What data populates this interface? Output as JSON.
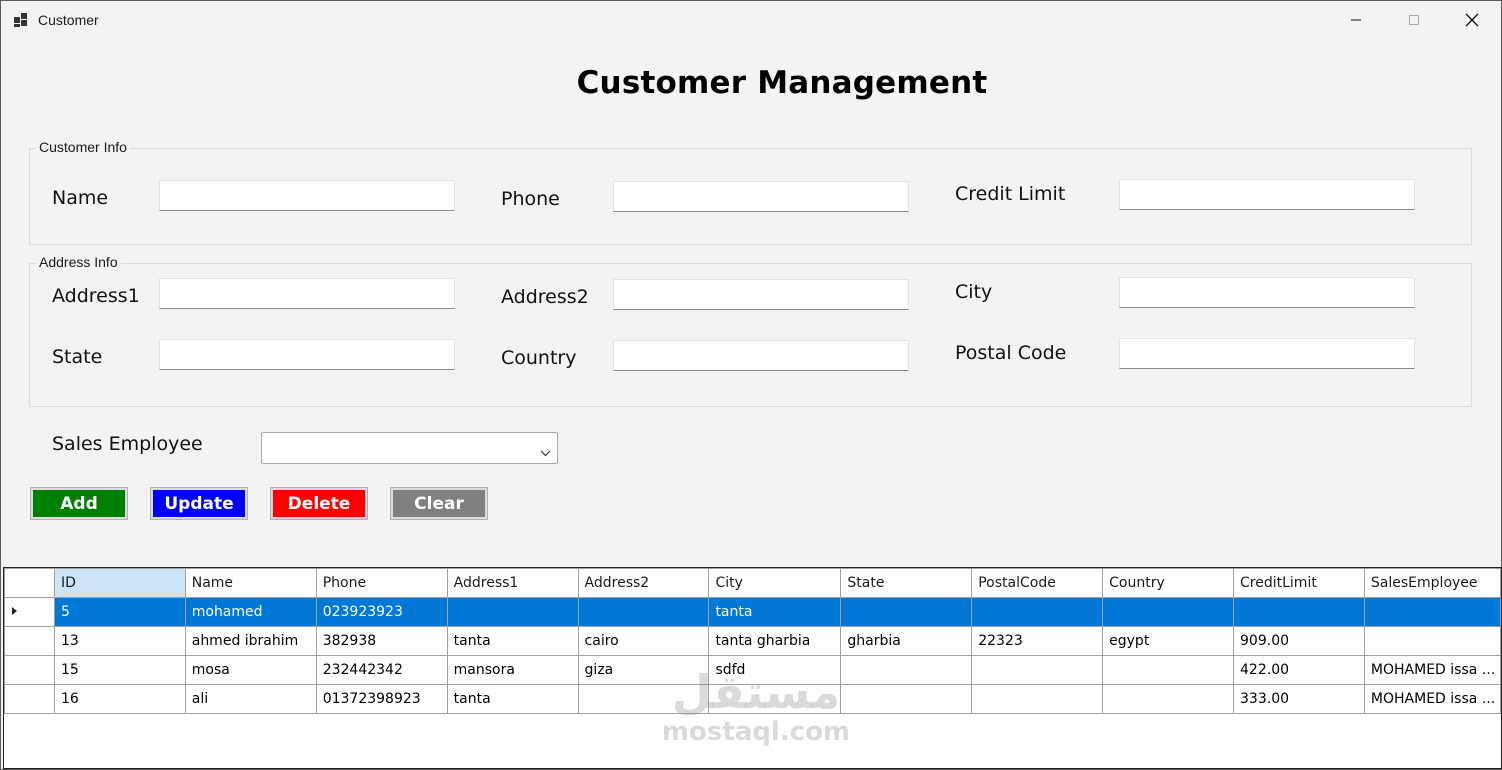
{
  "window": {
    "title": "Customer"
  },
  "header": {
    "title": "Customer Management"
  },
  "customer_info": {
    "legend": "Customer Info",
    "name_label": "Name",
    "name_value": "",
    "phone_label": "Phone",
    "phone_value": "",
    "credit_label": "Credit Limit",
    "credit_value": ""
  },
  "address_info": {
    "legend": "Address Info",
    "address1_label": "Address1",
    "address1_value": "",
    "address2_label": "Address2",
    "address2_value": "",
    "city_label": "City",
    "city_value": "",
    "state_label": "State",
    "state_value": "",
    "country_label": "Country",
    "country_value": "",
    "postal_label": "Postal Code",
    "postal_value": ""
  },
  "sales": {
    "label": "Sales Employee",
    "selected": ""
  },
  "buttons": {
    "add": "Add",
    "update": "Update",
    "delete": "Delete",
    "clear": "Clear",
    "colors": {
      "add": "#008000",
      "update": "#0000ff",
      "delete": "#ff0000",
      "clear": "#808080"
    }
  },
  "grid": {
    "columns": [
      "ID",
      "Name",
      "Phone",
      "Address1",
      "Address2",
      "City",
      "State",
      "PostalCode",
      "Country",
      "CreditLimit",
      "SalesEmployee"
    ],
    "rows": [
      [
        "5",
        "mohamed",
        "023923923",
        "",
        "",
        "tanta",
        "",
        "",
        "",
        "",
        ""
      ],
      [
        "13",
        "ahmed ibrahim",
        "382938",
        "tanta",
        "cairo",
        "tanta gharbia",
        "gharbia",
        "22323",
        "egypt",
        "909.00",
        ""
      ],
      [
        "15",
        "mosa",
        "232442342",
        "mansora",
        "giza",
        "sdfd",
        "",
        "",
        "",
        "422.00",
        "MOHAMED issa ..."
      ],
      [
        "16",
        "ali",
        "01372398923",
        "tanta",
        "",
        "",
        "",
        "",
        "",
        "333.00",
        "MOHAMED issa ..."
      ]
    ],
    "selected_row": 0,
    "selection_color": "#0078d7"
  },
  "watermark": {
    "arabic": "مستقل",
    "site": "mostaql.com"
  }
}
